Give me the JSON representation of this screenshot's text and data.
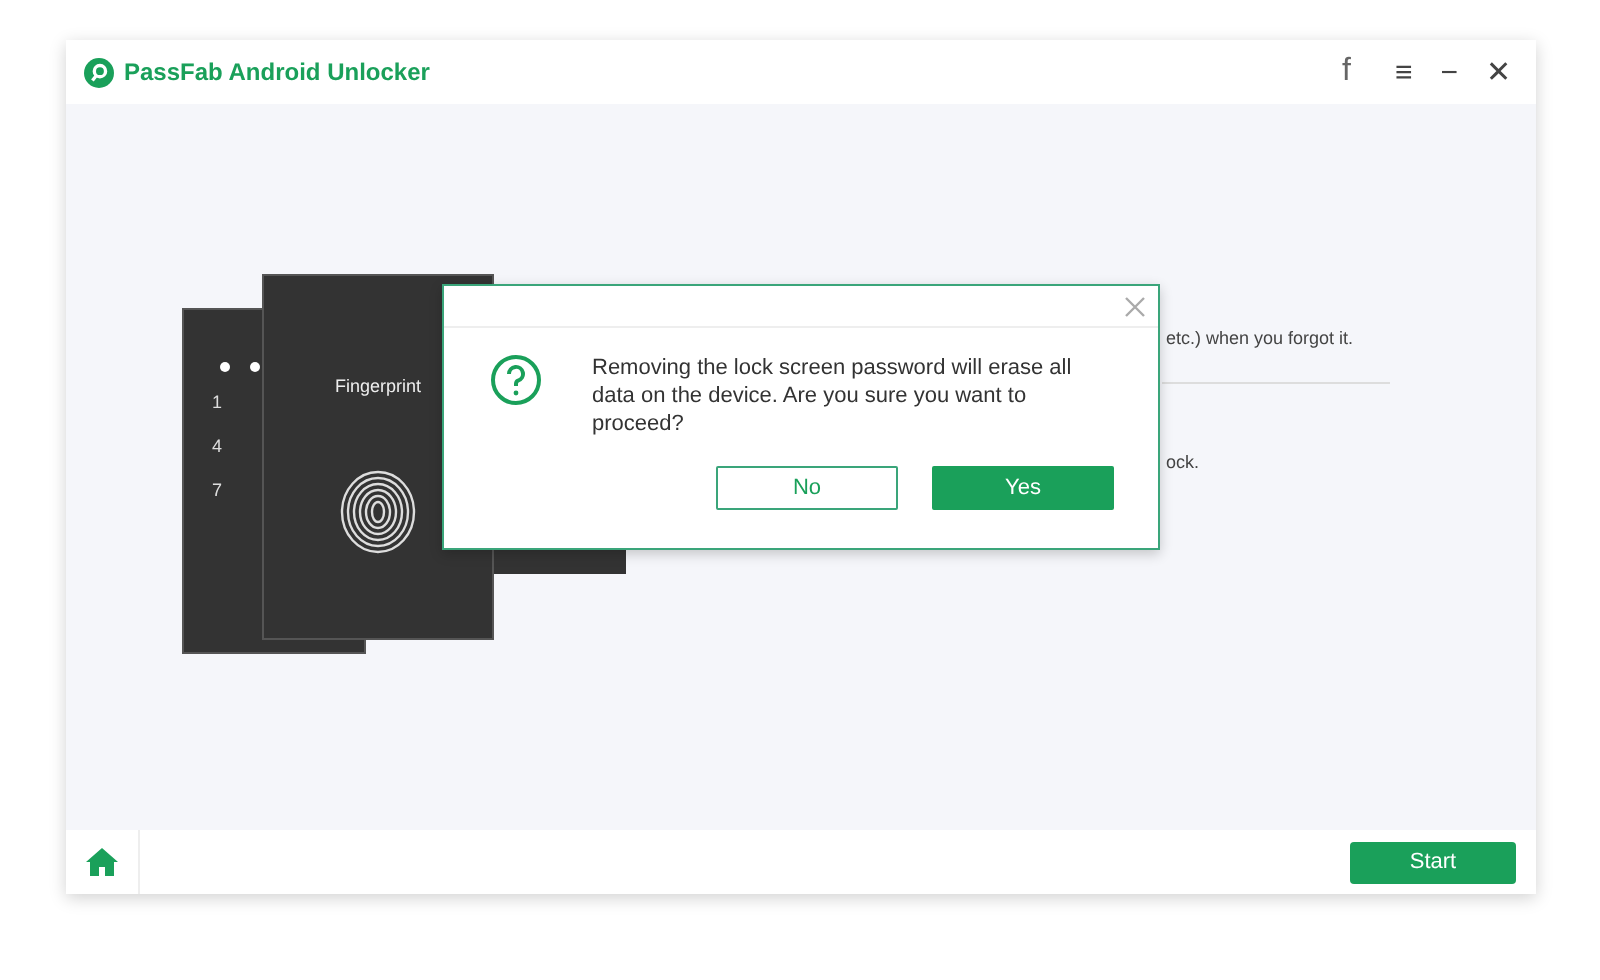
{
  "window": {
    "title": "PassFab Android Unlocker",
    "controls": [
      "f",
      "≡",
      "−",
      "✕"
    ]
  },
  "illustration": {
    "keypad_digits": [
      "1",
      "4",
      "7"
    ],
    "card_label": "Fingerprint"
  },
  "background_text": [
    "etc.) when you forgot it.",
    "ock."
  ],
  "dialog": {
    "message": "Removing the lock screen password will erase all data on the device. Are you sure you want to proceed?",
    "buttons": [
      {
        "label": "No",
        "kind": "secondary"
      },
      {
        "label": "Yes",
        "kind": "primary"
      }
    ]
  },
  "bottom_bar": {
    "start_button": "Start"
  }
}
